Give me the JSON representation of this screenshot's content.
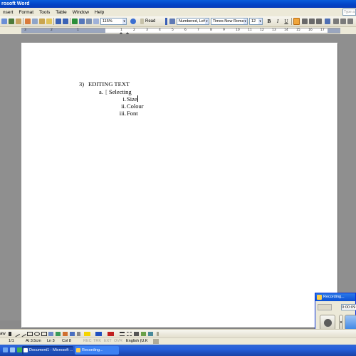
{
  "window": {
    "title": "rosoft Word"
  },
  "menu": {
    "items": [
      "nsert",
      "Format",
      "Tools",
      "Table",
      "Window",
      "Help"
    ],
    "help_placeholder": "Type a"
  },
  "toolbar": {
    "zoom": "115%",
    "read_label": "Read",
    "style": "Numbered, Left",
    "font": "Times New Roman",
    "size": "12",
    "bold": "B",
    "italic": "I",
    "underline": "U"
  },
  "ruler": {
    "numbers": [
      "3",
      "2",
      "1",
      "1",
      "2",
      "3",
      "4",
      "5",
      "6",
      "7",
      "8",
      "9",
      "10",
      "11",
      "12",
      "13",
      "14",
      "15",
      "16",
      "17"
    ]
  },
  "document": {
    "heading_num": "3)",
    "heading": "EDITING TEXT",
    "sub_num": "a.",
    "sub_text": "Selecting",
    "items": [
      {
        "num": "i.",
        "text": "Size"
      },
      {
        "num": "ii.",
        "text": "Colour"
      },
      {
        "num": "iii.",
        "text": "Font"
      }
    ]
  },
  "recording": {
    "title": "Recording...",
    "time": "0:00:09"
  },
  "drawbar": {
    "label": "aw"
  },
  "status": {
    "page": "1/1",
    "at": "At 3.5cm",
    "ln": "Ln 3",
    "col": "Col 8",
    "rec": "REC",
    "trk": "TRK",
    "ext": "EXT",
    "ovr": "OVR",
    "lang": "English (U.K"
  },
  "taskbar": {
    "tasks": [
      "Document1 - Microsoft ...",
      "Recording..."
    ]
  },
  "colors": {
    "titlebar": "#0343c5",
    "taskbar": "#245edb",
    "chrome": "#ece9d8"
  }
}
